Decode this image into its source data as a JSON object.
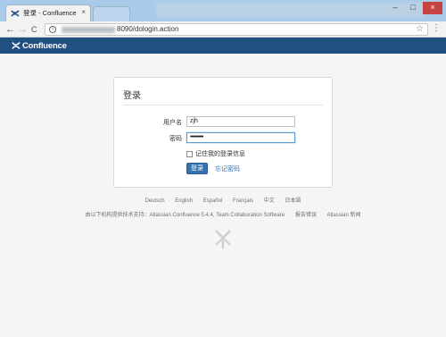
{
  "browser": {
    "tab_title": "登录 - Confluence",
    "tab_close": "×",
    "url": "8090/dologin.action",
    "controls": {
      "minimize": "–",
      "maximize": "□",
      "close": "×"
    },
    "nav": {
      "back": "←",
      "forward": "→",
      "reload": "C"
    },
    "info": "i",
    "star": "☆",
    "menu": "⋮"
  },
  "header": {
    "logo_text": "Confluence"
  },
  "login": {
    "title": "登录",
    "username_label": "用户名",
    "username_value": "zjh",
    "password_label": "密码",
    "password_value": "••••••••••",
    "remember_label": "记住我的登录信息",
    "login_button": "登录",
    "forgot_link": "忘记密码"
  },
  "languages": [
    "Deutsch",
    "English",
    "Español",
    "Français",
    "中文",
    "日本語"
  ],
  "footer": {
    "powered_by": "由以下机构提供技术支持：Atlassian Confluence 5.4.4, Team Collaboration Software",
    "report_bug": "报告错误",
    "news": "Atlassian 新闻"
  },
  "colors": {
    "brand_header": "#205081",
    "button": "#3572b0",
    "link": "#3572b0"
  }
}
